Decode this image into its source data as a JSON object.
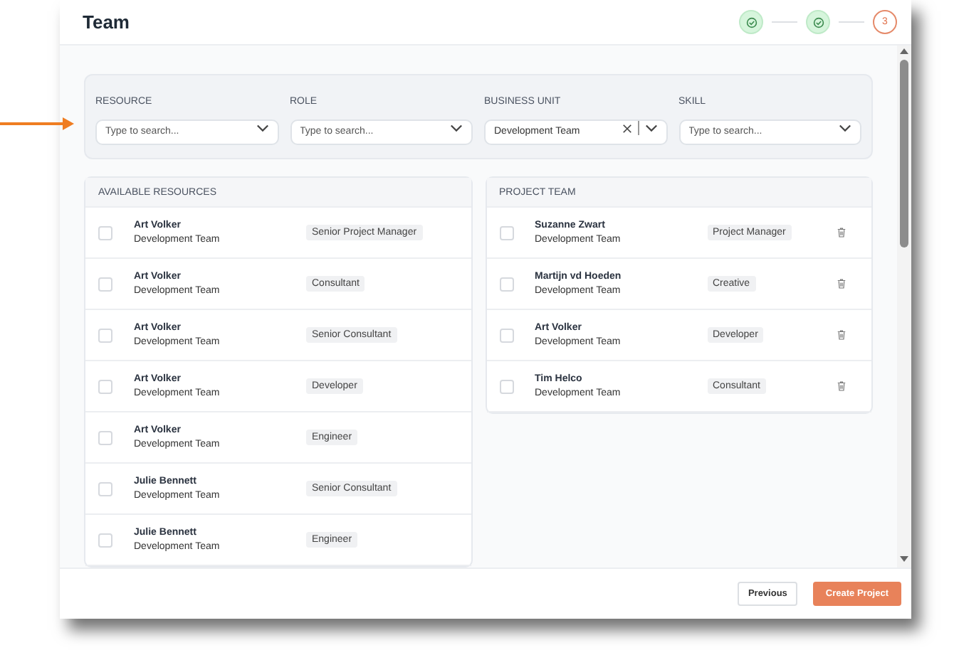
{
  "header": {
    "title": "Team"
  },
  "steps": [
    {
      "kind": "done"
    },
    {
      "kind": "done"
    },
    {
      "kind": "current",
      "label": "3"
    }
  ],
  "filters": [
    {
      "label": "RESOURCE",
      "placeholder": "Type to search..."
    },
    {
      "label": "ROLE",
      "placeholder": "Type to search..."
    },
    {
      "label": "BUSINESS UNIT",
      "value": "Development Team",
      "clearable": true
    },
    {
      "label": "SKILL",
      "placeholder": "Type to search..."
    }
  ],
  "available": {
    "title": "AVAILABLE RESOURCES",
    "rows": [
      {
        "name": "Art Volker",
        "unit": "Development Team",
        "role": "Senior Project Manager",
        "checked": false
      },
      {
        "name": "Art Volker",
        "unit": "Development Team",
        "role": "Consultant",
        "checked": false
      },
      {
        "name": "Art Volker",
        "unit": "Development Team",
        "role": "Senior Consultant",
        "checked": false
      },
      {
        "name": "Art Volker",
        "unit": "Development Team",
        "role": "Developer",
        "checked": false
      },
      {
        "name": "Art Volker",
        "unit": "Development Team",
        "role": "Engineer",
        "checked": false
      },
      {
        "name": "Julie Bennett",
        "unit": "Development Team",
        "role": "Senior Consultant",
        "checked": false
      },
      {
        "name": "Julie Bennett",
        "unit": "Development Team",
        "role": "Engineer",
        "checked": false
      }
    ]
  },
  "project_team": {
    "title": "PROJECT TEAM",
    "rows": [
      {
        "name": "Suzanne Zwart",
        "unit": "Development Team",
        "role": "Project Manager",
        "checked": false
      },
      {
        "name": "Martijn vd Hoeden",
        "unit": "Development Team",
        "role": "Creative",
        "checked": false
      },
      {
        "name": "Art Volker",
        "unit": "Development Team",
        "role": "Developer",
        "checked": false
      },
      {
        "name": "Tim Helco",
        "unit": "Development Team",
        "role": "Consultant",
        "checked": false
      }
    ]
  },
  "footer": {
    "buttons": [
      {
        "label": "Previous",
        "kind": "secondary"
      },
      {
        "label": "Create Project",
        "kind": "primary"
      }
    ]
  }
}
